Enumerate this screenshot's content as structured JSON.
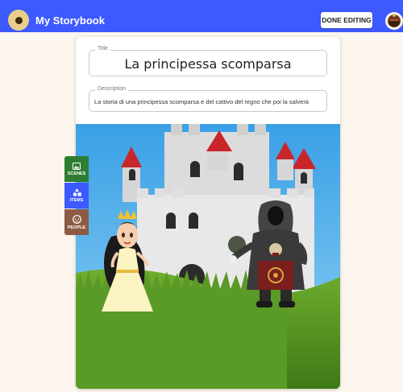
{
  "appbar": {
    "title": "My Storybook",
    "done_label": "DONE EDITING",
    "accent": "#3d5afe"
  },
  "story": {
    "title_label": "Title",
    "title_value": "La principessa scomparsa",
    "description_label": "Description",
    "description_value": "La storia di una principessa scomparsa e del cattivo del regno che poi la salverà"
  },
  "toolbar": {
    "scenes_label": "SCENES",
    "items_label": "ITEMS",
    "people_label": "PEOPLE",
    "scenes_icon": "image-icon",
    "items_icon": "shapes-icon",
    "people_icon": "face-icon"
  }
}
